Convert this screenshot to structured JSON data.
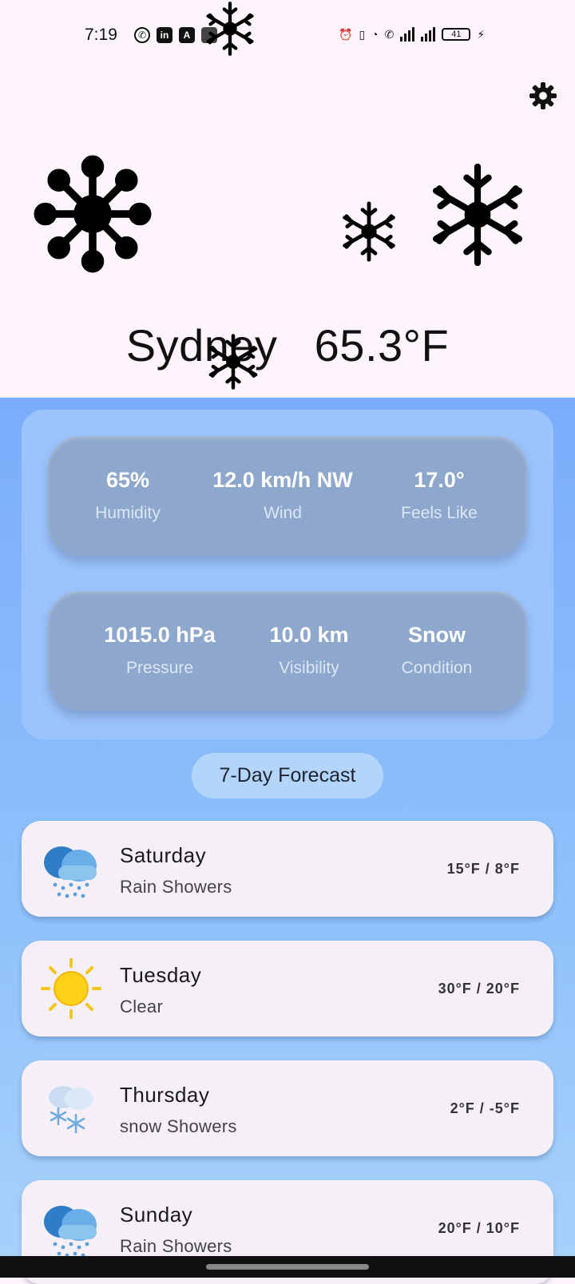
{
  "status_bar": {
    "time": "7:19",
    "apps": [
      "whatsapp-icon",
      "linkedin-icon",
      "app-a-icon",
      "app-generic-icon"
    ],
    "battery": "41"
  },
  "header": {
    "location": "Sydney",
    "temperature": "65.3°F"
  },
  "stats_row1": [
    {
      "value": "65%",
      "label": "Humidity"
    },
    {
      "value": "12.0 km/h NW",
      "label": "Wind"
    },
    {
      "value": "17.0°",
      "label": "Feels Like"
    }
  ],
  "stats_row2": [
    {
      "value": "1015.0 hPa",
      "label": "Pressure"
    },
    {
      "value": "10.0 km",
      "label": "Visibility"
    },
    {
      "value": "Snow",
      "label": "Condition"
    }
  ],
  "forecast": {
    "title": "7-Day Forecast",
    "days": [
      {
        "day": "Saturday",
        "condition": "Rain Showers",
        "temps": "15°F / 8°F",
        "icon": "rain-cloud-icon"
      },
      {
        "day": "Tuesday",
        "condition": "Clear",
        "temps": "30°F / 20°F",
        "icon": "sun-icon"
      },
      {
        "day": "Thursday",
        "condition": "snow Showers",
        "temps": "2°F / -5°F",
        "icon": "snow-cloud-icon"
      },
      {
        "day": "Sunday",
        "condition": "Rain Showers",
        "temps": "20°F / 10°F",
        "icon": "rain-cloud-icon"
      }
    ]
  },
  "colors": {
    "top_background": "#fdf5fb",
    "lower_background": "#7aadfb",
    "stat_card": "#8ea7cc",
    "day_card": "#f5f0f7"
  }
}
